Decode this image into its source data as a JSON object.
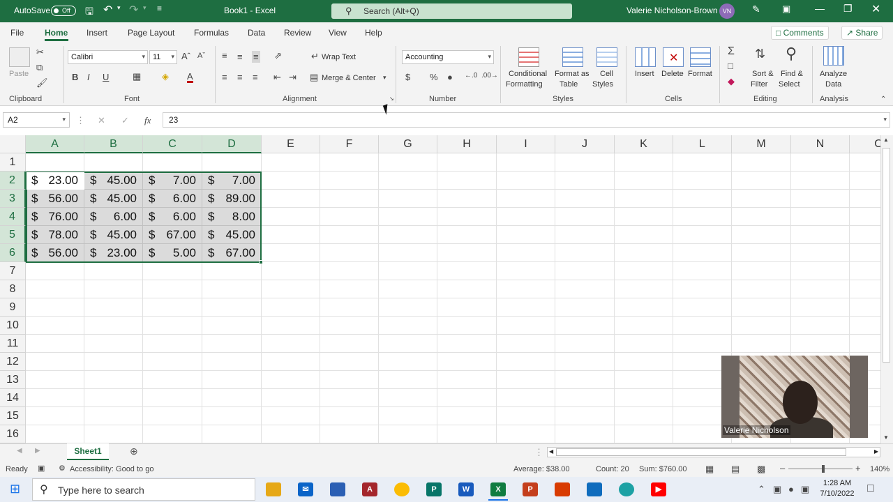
{
  "titlebar": {
    "autosave_label": "AutoSave",
    "autosave_state": "Off",
    "doc_title": "Book1  -  Excel",
    "search_placeholder": "Search (Alt+Q)",
    "user_name": "Valerie Nicholson-Brown",
    "user_initials": "VN"
  },
  "menu": {
    "tabs": [
      "File",
      "Home",
      "Insert",
      "Page Layout",
      "Formulas",
      "Data",
      "Review",
      "View",
      "Help"
    ],
    "active_tab": "Home",
    "comments_label": "Comments",
    "share_label": "Share"
  },
  "ribbon": {
    "clipboard": {
      "label": "Clipboard",
      "paste": "Paste"
    },
    "font": {
      "label": "Font",
      "family": "Calibri",
      "size": "11",
      "bold": "B",
      "italic": "I",
      "underline": "U"
    },
    "alignment": {
      "label": "Alignment",
      "wrap_text": "Wrap Text",
      "merge_center": "Merge & Center"
    },
    "number": {
      "label": "Number",
      "format": "Accounting"
    },
    "styles": {
      "label": "Styles",
      "conditional": "Conditional",
      "conditional2": "Formatting",
      "format_as": "Format as",
      "format_as2": "Table",
      "cell": "Cell",
      "cell2": "Styles"
    },
    "cells": {
      "label": "Cells",
      "insert": "Insert",
      "delete": "Delete",
      "format": "Format"
    },
    "editing": {
      "label": "Editing",
      "sort": "Sort &",
      "sort2": "Filter",
      "find": "Find &",
      "find2": "Select"
    },
    "analysis": {
      "label": "Analysis",
      "analyze": "Analyze",
      "analyze2": "Data"
    }
  },
  "formula_bar": {
    "name_box": "A2",
    "fx": "fx",
    "content": "23"
  },
  "grid": {
    "columns": [
      "A",
      "B",
      "C",
      "D",
      "E",
      "F",
      "G",
      "H",
      "I",
      "J",
      "K",
      "L",
      "M",
      "N",
      "O"
    ],
    "selected_columns": [
      "A",
      "B",
      "C",
      "D"
    ],
    "rows": [
      "1",
      "2",
      "3",
      "4",
      "5",
      "6",
      "7",
      "8",
      "9",
      "10",
      "11",
      "12",
      "13",
      "14",
      "15",
      "16"
    ],
    "selected_rows": [
      "2",
      "3",
      "4",
      "5",
      "6"
    ],
    "currency_symbol": "$",
    "cells": [
      [
        "23.00",
        "45.00",
        "7.00",
        "7.00"
      ],
      [
        "56.00",
        "45.00",
        "6.00",
        "89.00"
      ],
      [
        "76.00",
        "6.00",
        "6.00",
        "8.00"
      ],
      [
        "78.00",
        "45.00",
        "67.00",
        "45.00"
      ],
      [
        "56.00",
        "23.00",
        "5.00",
        "67.00"
      ]
    ]
  },
  "sheets": {
    "tabs": [
      "Sheet1"
    ],
    "active": "Sheet1"
  },
  "statusbar": {
    "ready": "Ready",
    "accessibility": "Accessibility: Good to go",
    "average": "Average: $38.00",
    "count": "Count: 20",
    "sum": "Sum: $760.00",
    "zoom": "140%"
  },
  "webcam": {
    "name": "Valerie Nicholson"
  },
  "taskbar": {
    "search_placeholder": "Type here to search",
    "time": "1:28 AM",
    "date": "7/10/2022"
  }
}
